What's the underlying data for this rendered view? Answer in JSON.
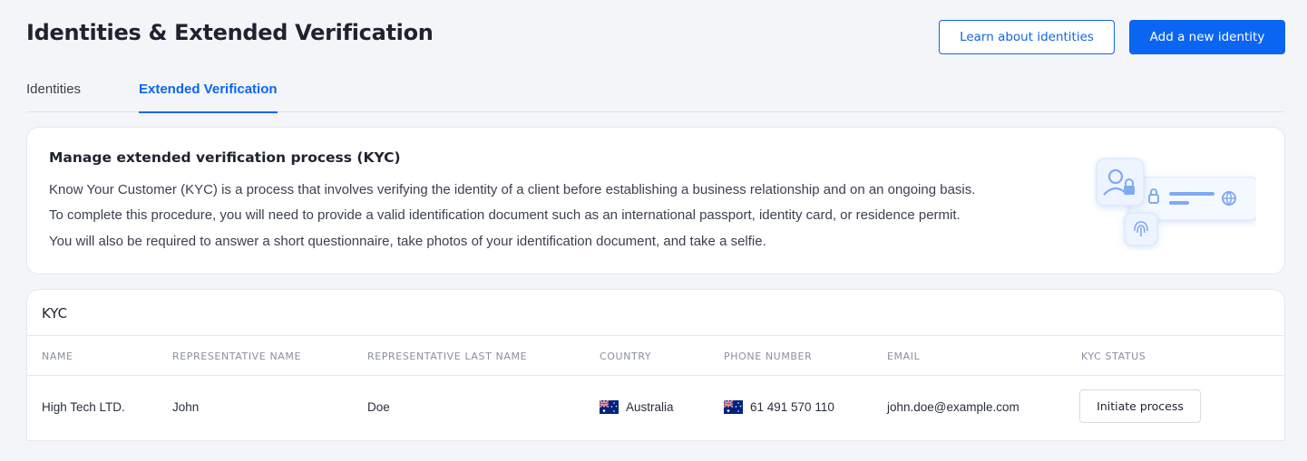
{
  "page": {
    "title": "Identities & Extended Verification",
    "learn_button": "Learn about identities",
    "add_button": "Add a new identity"
  },
  "tabs": [
    {
      "label": "Identities",
      "active": false
    },
    {
      "label": "Extended Verification",
      "active": true
    }
  ],
  "info": {
    "title": "Manage extended verification process (KYC)",
    "lines": [
      "Know Your Customer (KYC) is a process that involves verifying the identity of a client before establishing a business relationship and on an ongoing basis.",
      "To complete this procedure, you will need to provide a valid identification document such as an international passport, identity card, or residence permit.",
      "You will also be required to answer a short questionnaire, take photos of your identification document, and take a selfie."
    ]
  },
  "table": {
    "title": "KYC",
    "columns": [
      "NAME",
      "REPRESENTATIVE NAME",
      "REPRESENTATIVE LAST NAME",
      "COUNTRY",
      "PHONE NUMBER",
      "EMAIL",
      "KYC STATUS"
    ],
    "rows": [
      {
        "name": "High Tech LTD.",
        "rep_name": "John",
        "rep_last_name": "Doe",
        "country": "Australia",
        "country_flag": "australia-flag",
        "phone": "61 491 570 110",
        "phone_flag": "australia-flag",
        "email": "john.doe@example.com",
        "status_action": "Initiate process"
      }
    ]
  },
  "colors": {
    "accent": "#0a66f2",
    "background": "#f4f5f9",
    "card": "#ffffff"
  }
}
